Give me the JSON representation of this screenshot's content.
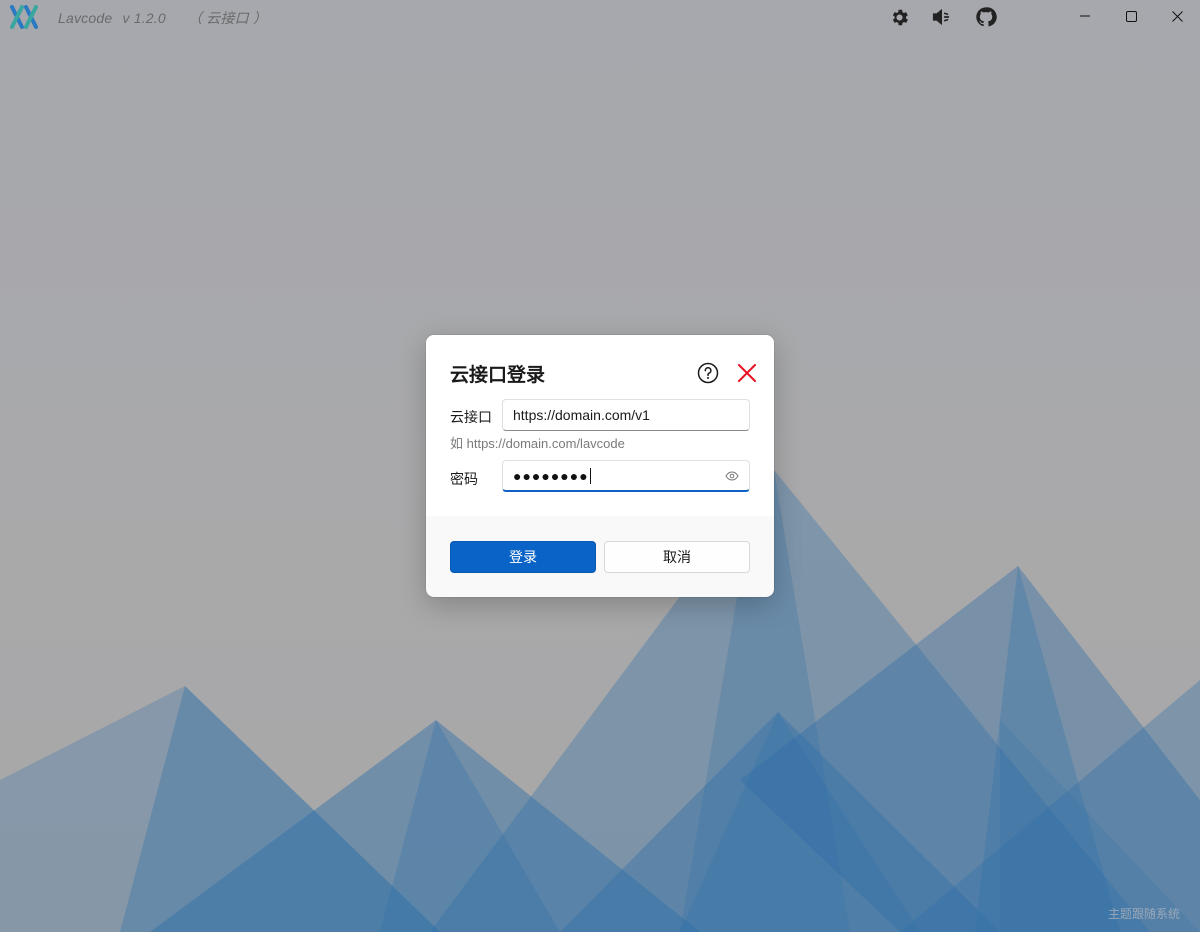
{
  "window": {
    "app_name": "Lavcode",
    "version": "v 1.2.0",
    "mode": "（ 云接口 ）"
  },
  "toolbar": {
    "settings_icon": "gear-icon",
    "sound_icon": "speaker-muted-icon",
    "github_icon": "github-icon"
  },
  "window_controls": {
    "minimize_icon": "minimize-icon",
    "maximize_icon": "maximize-icon",
    "close_icon": "close-icon"
  },
  "dialog": {
    "title": "云接口登录",
    "api_label": "云接口",
    "api_value": "https://domain.com/v1",
    "api_hint": "如 https://domain.com/lavcode",
    "password_label": "密码",
    "password_dots": "●●●●●●●●",
    "login_button": "登录",
    "cancel_button": "取消"
  },
  "footer": {
    "theme_text": "主题跟随系统"
  },
  "colors": {
    "primary": "#0a63c6",
    "close_red": "#e81123",
    "background": "#a9a9ab",
    "mountain_blue": "#2a6aa6"
  }
}
